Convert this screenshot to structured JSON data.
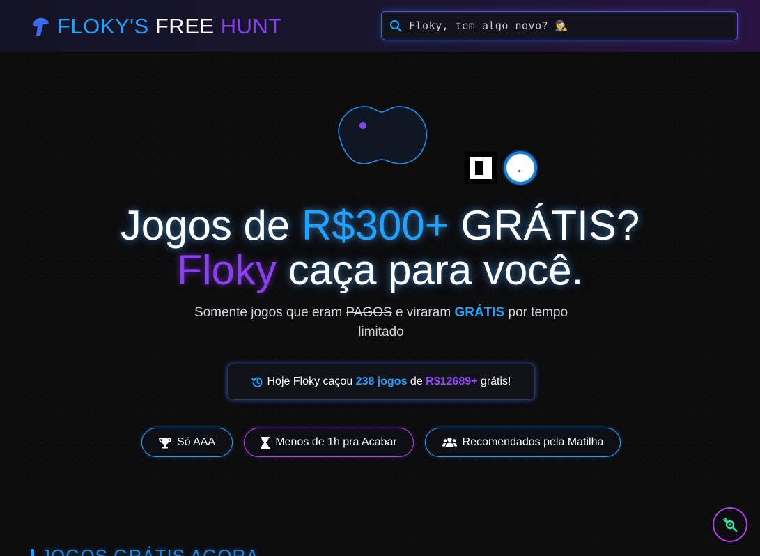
{
  "brand": {
    "part1": "FLOKY'S",
    "part2": "FREE",
    "part3": "HUNT",
    "icon": "dog-head-icon",
    "colors": {
      "blue": "#1ea1ff",
      "white": "#ffffff",
      "purple": "#8a3ff0"
    }
  },
  "search": {
    "placeholder": "Floky, tem algo novo? 🕵",
    "value": "",
    "icon": "search-icon"
  },
  "hero": {
    "store_icons": [
      "epic-games-icon",
      "steam-icon"
    ],
    "headline": {
      "line1_pre": "Jogos de ",
      "line1_highlight": "R$300+",
      "line1_post": " GRÁTIS?",
      "line2_highlight": "Floky",
      "line2_post": " caça para você."
    },
    "subline": {
      "pre": "Somente jogos que eram ",
      "struck": "PAGOS",
      "mid": " e viraram ",
      "strong": "GRÁTIS",
      "post": " por tempo limitado"
    }
  },
  "stats": {
    "icon": "history-icon",
    "pre": "Hoje Floky caçou ",
    "games": "238 jogos",
    "mid": " de ",
    "value": "R$12689+",
    "post": " grátis!"
  },
  "filters": [
    {
      "label": "Só AAA",
      "icon": "trophy-icon",
      "accent": "#1ea1ff"
    },
    {
      "label": "Menos de 1h pra Acabar",
      "icon": "hourglass-icon",
      "accent": "#b33ef0"
    },
    {
      "label": "Recomendados pela Matilha",
      "icon": "users-icon",
      "accent": "#1ea1ff"
    }
  ],
  "fab": {
    "icon": "paw-icon",
    "accent": "#2ee6a0"
  },
  "section_peek": {
    "title": "JOGOS GRÁTIS AGORA"
  }
}
